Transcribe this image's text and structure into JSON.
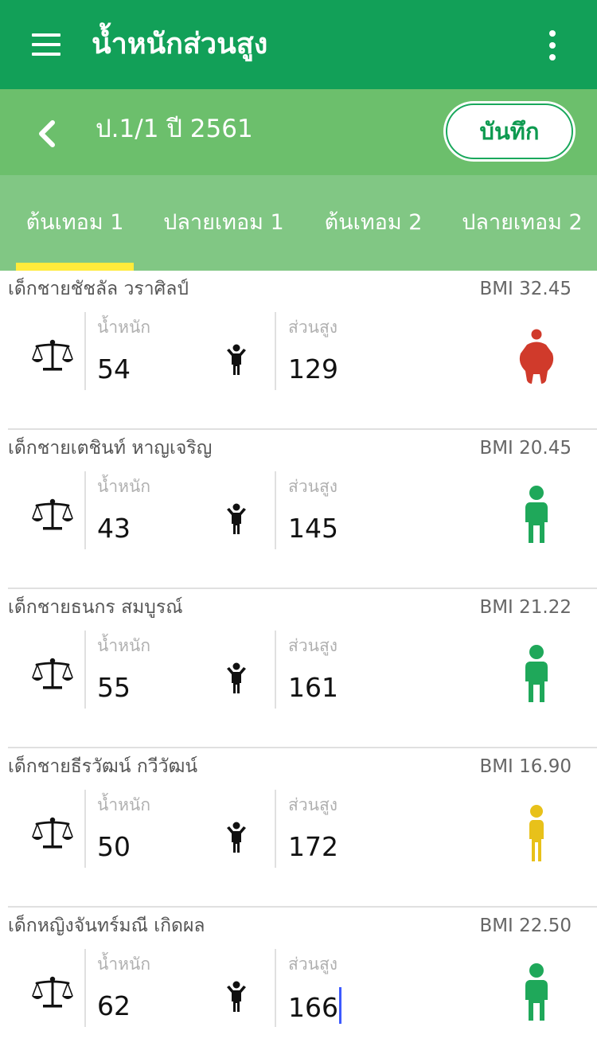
{
  "app": {
    "title": "น้ำหนักส่วนสูง",
    "menu_icon": "hamburger-menu-icon",
    "more_icon": "more-vertical-icon"
  },
  "subheader": {
    "class_title": "ป.1/1 ปี 2561",
    "back_icon": "chevron-left-icon",
    "save_label": "บันทึก"
  },
  "tabs": [
    {
      "label": "ต้นเทอม 1",
      "selected": true
    },
    {
      "label": "ปลายเทอม 1",
      "selected": false
    },
    {
      "label": "ต้นเทอม 2",
      "selected": false
    },
    {
      "label": "ปลายเทอม 2",
      "selected": false
    }
  ],
  "labels": {
    "weight": "น้ำหนัก",
    "height": "ส่วนสูง"
  },
  "students": [
    {
      "name": "เด็กชายชัชลัล วราศิลป์",
      "bmi": "BMI 32.45",
      "weight": "54",
      "height": "129",
      "status_color": "#d03a2b",
      "figure": "obese"
    },
    {
      "name": "เด็กชายเตชินท์ หาญเจริญ",
      "bmi": "BMI 20.45",
      "weight": "43",
      "height": "145",
      "status_color": "#1fa85a",
      "figure": "normal"
    },
    {
      "name": "เด็กชายธนกร สมบูรณ์",
      "bmi": "BMI 21.22",
      "weight": "55",
      "height": "161",
      "status_color": "#1fa85a",
      "figure": "normal"
    },
    {
      "name": "เด็กชายธีรวัฒน์ กวีวัฒน์",
      "bmi": "BMI 16.90",
      "weight": "50",
      "height": "172",
      "status_color": "#e8c11a",
      "figure": "thin"
    },
    {
      "name": "เด็กหญิงจันทร์มณี เกิดผล",
      "bmi": "BMI 22.50",
      "weight": "62",
      "height": "166",
      "status_color": "#1fa85a",
      "figure": "normal"
    }
  ],
  "colors": {
    "primary": "#12a058",
    "subheader": "#6cbf6c",
    "tabbar": "#81c784",
    "indicator": "#ffeb3b"
  }
}
